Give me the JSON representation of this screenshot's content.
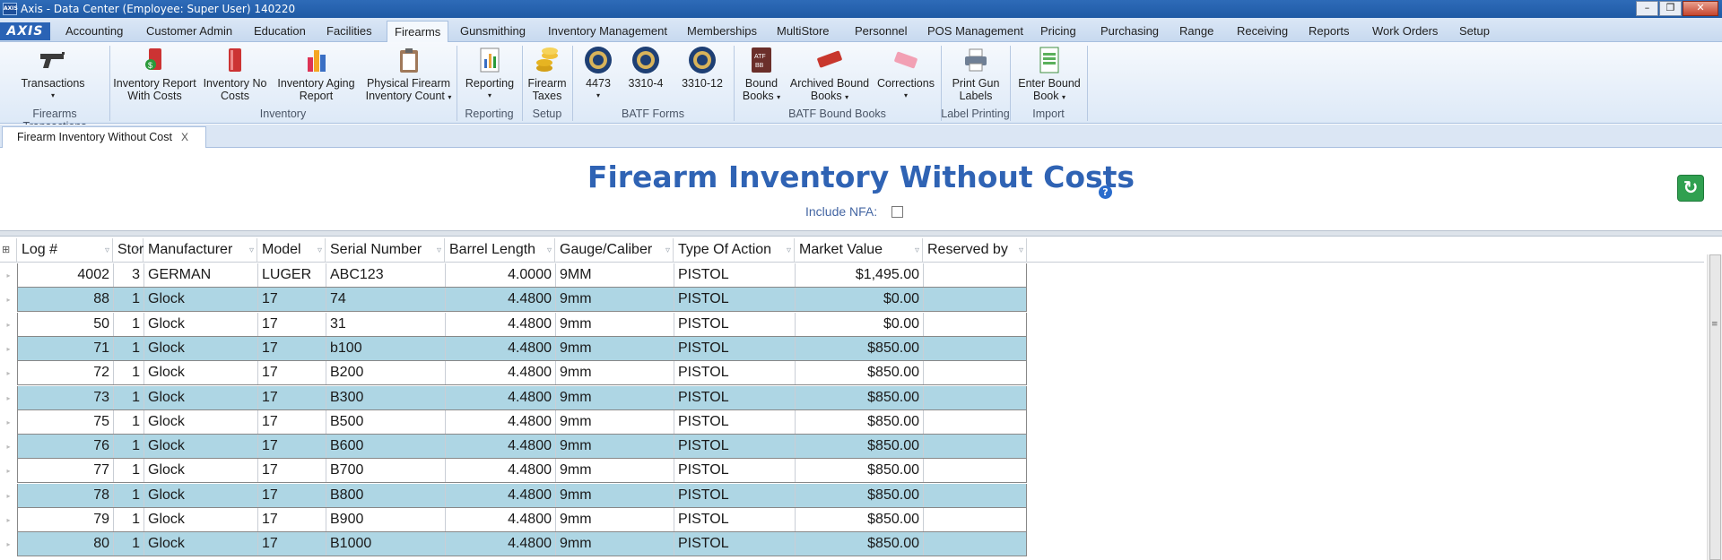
{
  "window": {
    "title": "Axis - Data Center  (Employee: Super User) 140220",
    "app_icon": "AXIS",
    "buttons": [
      "–",
      "❐",
      "✕"
    ]
  },
  "logo": "AXIS",
  "tabs": [
    "Accounting",
    "Customer Admin",
    "Education",
    "Facilities",
    "Firearms",
    "Gunsmithing",
    "Inventory Management",
    "Memberships",
    "MultiStore",
    "Personnel",
    "POS Management",
    "Pricing",
    "Purchasing",
    "Range",
    "Receiving",
    "Reports",
    "Work Orders",
    "Setup"
  ],
  "active_tab": "Firearms",
  "ribbon": {
    "transactions": "Transactions",
    "inv_report_costs": [
      "Inventory Report",
      "With Costs"
    ],
    "inv_no_costs": [
      "Inventory No",
      "Costs"
    ],
    "inv_aging": [
      "Inventory Aging",
      "Report"
    ],
    "physical_count": [
      "Physical Firearm",
      "Inventory Count"
    ],
    "reporting": "Reporting",
    "firearm_taxes": [
      "Firearm",
      "Taxes"
    ],
    "f4473": "4473",
    "f3310_4": "3310-4",
    "f3310_12": "3310-12",
    "bound_books": [
      "Bound",
      "Books"
    ],
    "archived_bound_books": [
      "Archived Bound",
      "Books"
    ],
    "corrections": "Corrections",
    "print_gun_labels": [
      "Print Gun",
      "Labels"
    ],
    "enter_bound_book": [
      "Enter Bound",
      "Book"
    ],
    "groups": {
      "firearms_transactions": "Firearms Transactions",
      "inventory": "Inventory",
      "reporting": "Reporting",
      "setup": "Setup",
      "batf_forms": "BATF Forms",
      "batf_bound_books": "BATF Bound Books",
      "label_printing": "Label Printing",
      "import": "Import"
    }
  },
  "doc_tab": {
    "label": "Firearm Inventory Without Cost",
    "close": "X"
  },
  "page": {
    "title": "Firearm Inventory Without Costs",
    "include_nfa_label": "Include NFA:",
    "include_nfa_checked": false
  },
  "columns": [
    "Log #",
    "Store",
    "Manufacturer",
    "Model",
    "Serial Number",
    "Barrel Length",
    "Gauge/Caliber",
    "Type Of Action",
    "Market Value",
    "Reserved by"
  ],
  "rows": [
    [
      "4002",
      "3",
      "GERMAN",
      "LUGER",
      "ABC123",
      "4.0000",
      "9MM",
      "PISTOL",
      "$1,495.00",
      ""
    ],
    [
      "88",
      "1",
      "Glock",
      "17",
      "74",
      "4.4800",
      "9mm",
      "PISTOL",
      "$0.00",
      ""
    ],
    [
      "50",
      "1",
      "Glock",
      "17",
      "31",
      "4.4800",
      "9mm",
      "PISTOL",
      "$0.00",
      ""
    ],
    [
      "71",
      "1",
      "Glock",
      "17",
      "b100",
      "4.4800",
      "9mm",
      "PISTOL",
      "$850.00",
      ""
    ],
    [
      "72",
      "1",
      "Glock",
      "17",
      "B200",
      "4.4800",
      "9mm",
      "PISTOL",
      "$850.00",
      ""
    ],
    [
      "73",
      "1",
      "Glock",
      "17",
      "B300",
      "4.4800",
      "9mm",
      "PISTOL",
      "$850.00",
      ""
    ],
    [
      "75",
      "1",
      "Glock",
      "17",
      "B500",
      "4.4800",
      "9mm",
      "PISTOL",
      "$850.00",
      ""
    ],
    [
      "76",
      "1",
      "Glock",
      "17",
      "B600",
      "4.4800",
      "9mm",
      "PISTOL",
      "$850.00",
      ""
    ],
    [
      "77",
      "1",
      "Glock",
      "17",
      "B700",
      "4.4800",
      "9mm",
      "PISTOL",
      "$850.00",
      ""
    ],
    [
      "78",
      "1",
      "Glock",
      "17",
      "B800",
      "4.4800",
      "9mm",
      "PISTOL",
      "$850.00",
      ""
    ],
    [
      "79",
      "1",
      "Glock",
      "17",
      "B900",
      "4.4800",
      "9mm",
      "PISTOL",
      "$850.00",
      ""
    ],
    [
      "80",
      "1",
      "Glock",
      "17",
      "B1000",
      "4.4800",
      "9mm",
      "PISTOL",
      "$850.00",
      ""
    ]
  ],
  "colors": {
    "accent": "#2f63b4",
    "row_alt": "#aed6e4",
    "refresh": "#30a050"
  }
}
